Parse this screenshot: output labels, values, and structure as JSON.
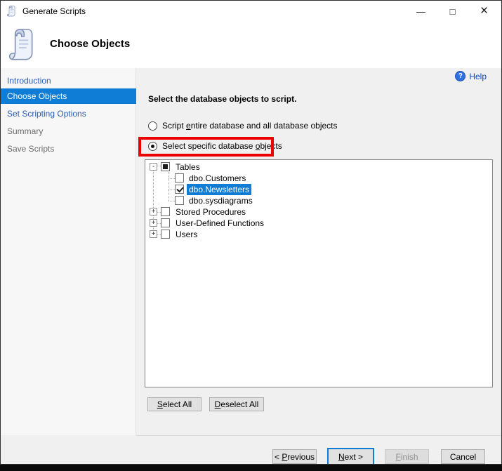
{
  "window": {
    "title": "Generate Scripts"
  },
  "icons": {
    "minimize": "—",
    "maximize": "□",
    "close": "×",
    "help": "?",
    "app": "script-scroll"
  },
  "header": {
    "title": "Choose Objects"
  },
  "sidebar": {
    "items": [
      {
        "label": "Introduction",
        "state": "link"
      },
      {
        "label": "Choose Objects",
        "state": "selected"
      },
      {
        "label": "Set Scripting Options",
        "state": "link"
      },
      {
        "label": "Summary",
        "state": "disabled"
      },
      {
        "label": "Save Scripts",
        "state": "disabled"
      }
    ]
  },
  "content": {
    "help": {
      "label": "Help"
    },
    "instruction": "Select the database objects to script.",
    "radios": {
      "entire": {
        "pre": "Script ",
        "mnemonic": "e",
        "post": "ntire database and all database objects",
        "selected": false
      },
      "specific": {
        "pre": "Select specific database ",
        "mnemonic": "o",
        "post": "bjects",
        "selected": true,
        "annotation": "red-box"
      }
    },
    "tree": {
      "items": [
        {
          "label": "Tables",
          "level": 0,
          "expander_glyph": "-",
          "expanded": true,
          "checkbox": "indeterminate",
          "selected": false
        },
        {
          "label": "dbo.Customers",
          "level": 1,
          "expander_glyph": "",
          "checkbox": "unchecked",
          "selected": false
        },
        {
          "label": "dbo.Newsletters",
          "level": 1,
          "expander_glyph": "",
          "checkbox": "checked",
          "selected": true
        },
        {
          "label": "dbo.sysdiagrams",
          "level": 1,
          "expander_glyph": "",
          "checkbox": "unchecked",
          "selected": false
        },
        {
          "label": "Stored Procedures",
          "level": 0,
          "expander_glyph": "+",
          "expanded": false,
          "checkbox": "unchecked",
          "selected": false
        },
        {
          "label": "User-Defined Functions",
          "level": 0,
          "expander_glyph": "+",
          "expanded": false,
          "checkbox": "unchecked",
          "selected": false
        },
        {
          "label": "Users",
          "level": 0,
          "expander_glyph": "+",
          "expanded": false,
          "checkbox": "unchecked",
          "selected": false
        }
      ]
    },
    "buttons": {
      "select_all": {
        "mnemonic": "S",
        "post": "elect All"
      },
      "deselect_all": {
        "mnemonic": "D",
        "post": "eselect All"
      }
    }
  },
  "footer": {
    "previous": {
      "pre": "< ",
      "mnemonic": "P",
      "post": "revious"
    },
    "next": {
      "mnemonic": "N",
      "post": "ext >"
    },
    "finish": {
      "mnemonic": "F",
      "post": "inish",
      "disabled": true
    },
    "cancel": "Cancel"
  },
  "colors": {
    "selection_blue": "#0f7cd6",
    "annotation_red": "#ec0000",
    "link_blue": "#2a5db0",
    "disabled_text": "#6d6d6d",
    "panel_gray": "#f0f0f0"
  }
}
